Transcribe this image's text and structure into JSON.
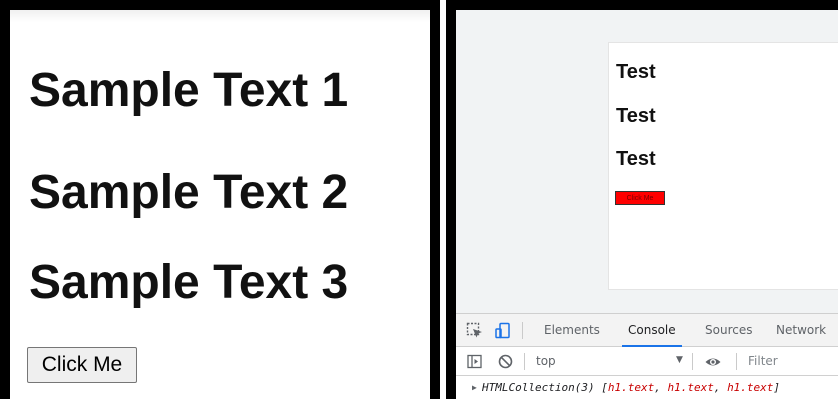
{
  "left": {
    "headings": [
      "Sample Text 1",
      "Sample Text 2",
      "Sample Text 3"
    ],
    "button_label": "Click Me"
  },
  "right": {
    "page": {
      "headings": [
        "Test",
        "Test",
        "Test"
      ],
      "button_label": "Click Me",
      "button_color": "#ff0000"
    },
    "devtools": {
      "tabs": [
        "Elements",
        "Console",
        "Sources",
        "Network"
      ],
      "active_tab": "Console",
      "context": "top",
      "filter_placeholder": "Filter",
      "console_output": {
        "prefix": "HTMLCollection(3) [",
        "items": [
          "h1.text",
          "h1.text",
          "h1.text"
        ],
        "suffix": "]"
      }
    }
  }
}
